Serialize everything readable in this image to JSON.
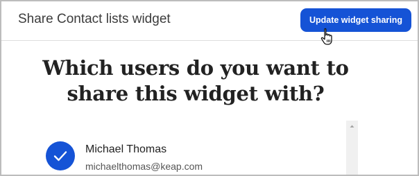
{
  "modal": {
    "title": "Share Contact lists widget",
    "update_button_label": "Update widget sharing",
    "question_line1": "Which users do you want to",
    "question_line2": "share this widget with?"
  },
  "users": [
    {
      "name": "Michael Thomas",
      "email": "michaelthomas@keap.com",
      "selected": true
    }
  ],
  "colors": {
    "accent": "#1553d6",
    "border": "#bcbcbc",
    "heading": "#222222"
  },
  "icons": {
    "check": "check-icon",
    "cursor": "hand-pointer-cursor-icon",
    "scroll_up": "scroll-up-arrow-icon"
  }
}
